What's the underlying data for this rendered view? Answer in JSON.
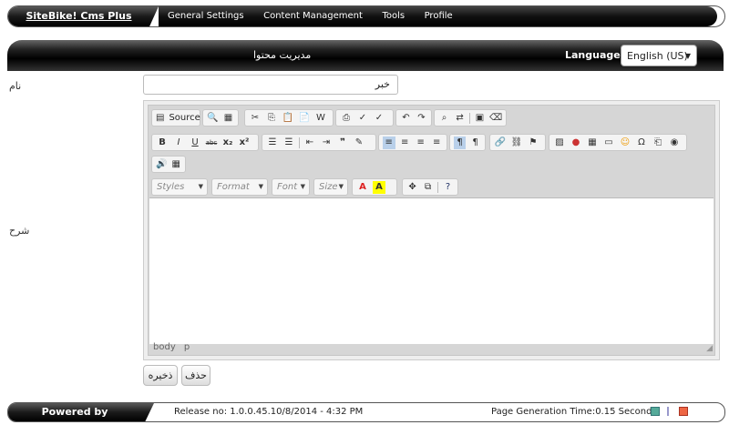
{
  "topbar": {
    "brand": "SiteBike! Cms Plus",
    "menu": [
      "General Settings",
      "Content Management",
      "Tools",
      "Profile"
    ]
  },
  "header": {
    "title": "مدیریت محتوا",
    "language_label": "Language:",
    "language_value": "English (US)"
  },
  "form": {
    "name_label": "نام",
    "name_value": "خبر",
    "desc_label": "شرح",
    "save_button": "ذخیره",
    "delete_button": "حذف"
  },
  "editor": {
    "source_label": "Source",
    "styles": "Styles",
    "format": "Format",
    "font": "Font",
    "size": "Size",
    "path": [
      "body",
      "p"
    ]
  },
  "footer": {
    "powered": "Powered by",
    "release": "Release no: 1.0.0.45.10/8/2014 - 4:32 PM",
    "gen_time": "Page Generation Time:0.15  Seconds"
  }
}
